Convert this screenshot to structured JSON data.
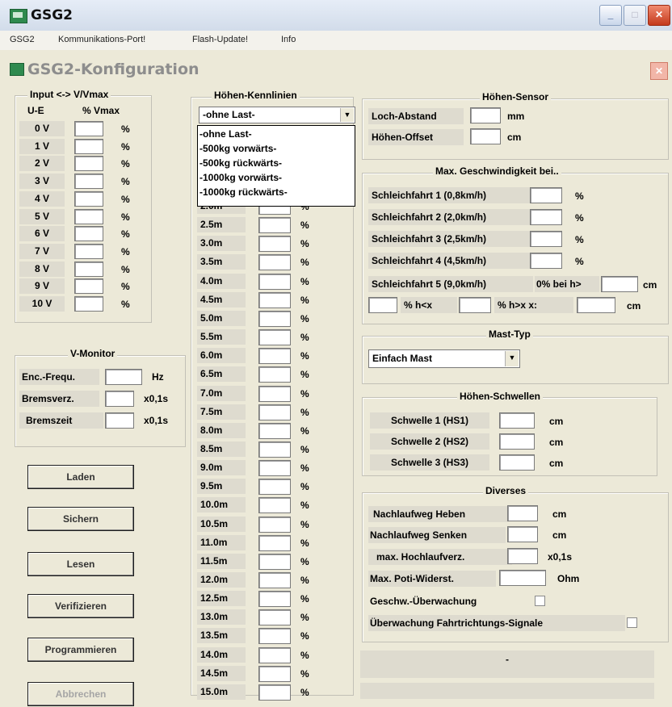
{
  "window": {
    "title": "GSG2"
  },
  "menu": [
    "GSG2",
    "Kommunikations-Port!",
    "Flash-Update!",
    "Info"
  ],
  "dialog": {
    "title": "GSG2-Konfiguration"
  },
  "input_group": {
    "title": "Input <-> V/Vmax",
    "col_ue": "U-E",
    "col_pct": "% Vmax",
    "unit": "%",
    "rows": [
      "0 V",
      "1 V",
      "2 V",
      "3 V",
      "4 V",
      "5 V",
      "6 V",
      "7 V",
      "8 V",
      "9 V",
      "10 V"
    ]
  },
  "vmonitor": {
    "title": "V-Monitor",
    "rows": [
      {
        "label": "Enc.-Frequ.",
        "unit": "Hz"
      },
      {
        "label": "Bremsverz.",
        "unit": "x0,1s"
      },
      {
        "label": "Bremszeit",
        "unit": "x0,1s"
      }
    ]
  },
  "buttons": {
    "laden": "Laden",
    "sichern": "Sichern",
    "lesen": "Lesen",
    "verifizieren": "Verifizieren",
    "programmieren": "Programmieren",
    "abbrechen": "Abbrechen"
  },
  "kennlinien": {
    "title": "Höhen-Kennlinien",
    "selected": "-ohne Last-",
    "options": [
      "-ohne Last-",
      "-500kg vorwärts-",
      "-500kg rückwärts-",
      "-1000kg vorwärts-",
      "-1000kg rückwärts-"
    ],
    "unit": "%",
    "rows": [
      "2.0m",
      "2.5m",
      "3.0m",
      "3.5m",
      "4.0m",
      "4.5m",
      "5.0m",
      "5.5m",
      "6.0m",
      "6.5m",
      "7.0m",
      "7.5m",
      "8.0m",
      "8.5m",
      "9.0m",
      "9.5m",
      "10.0m",
      "10.5m",
      "11.0m",
      "11.5m",
      "12.0m",
      "12.5m",
      "13.0m",
      "13.5m",
      "14.0m",
      "14.5m",
      "15.0m"
    ]
  },
  "sensor": {
    "title": "Höhen-Sensor",
    "loch": "Loch-Abstand",
    "loch_unit": "mm",
    "offset": "Höhen-Offset",
    "offset_unit": "cm"
  },
  "speed": {
    "title": "Max. Geschwindigkeit bei..",
    "rows": [
      "Schleichfahrt 1 (0,8km/h)",
      "Schleichfahrt 2 (2,0km/h)",
      "Schleichfahrt 3 (2,5km/h)",
      "Schleichfahrt 4 (4,5km/h)"
    ],
    "unit": "%",
    "row5": "Schleichfahrt 5 (9,0km/h)",
    "row5_mid": "0% bei h>",
    "row5_unit": "cm",
    "row6_a": "% h<x",
    "row6_b": "% h>x x:",
    "row6_unit": "cm"
  },
  "masttyp": {
    "title": "Mast-Typ",
    "selected": "Einfach Mast"
  },
  "schwellen": {
    "title": "Höhen-Schwellen",
    "rows": [
      "Schwelle 1 (HS1)",
      "Schwelle 2 (HS2)",
      "Schwelle 3 (HS3)"
    ],
    "unit": "cm"
  },
  "diverses": {
    "title": "Diverses",
    "heben": "Nachlaufweg Heben",
    "heben_unit": "cm",
    "senken": "Nachlaufweg Senken",
    "senken_unit": "cm",
    "hochlauf": "max. Hochlaufverz.",
    "hochlauf_unit": "x0,1s",
    "poti": "Max. Poti-Widerst.",
    "poti_unit": "Ohm",
    "geschw": "Geschw.-Überwachung",
    "fahrt": "Überwachung Fahrtrichtungs-Signale"
  },
  "status": {
    "text": "-"
  }
}
